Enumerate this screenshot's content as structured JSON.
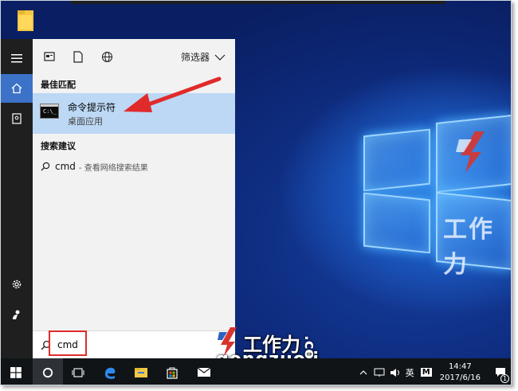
{
  "start_menu": {
    "filter_label": "筛选器",
    "best_match_heading": "最佳匹配",
    "best_match": {
      "title": "命令提示符",
      "subtitle": "桌面应用"
    },
    "suggestions_heading": "搜索建议",
    "suggestion": {
      "query": "cmd",
      "suffix": "- 查看网络搜索结果"
    },
    "search_value": "cmd",
    "icons": [
      "documents-icon",
      "file-icon",
      "web-icon",
      "filter-chevron-icon"
    ]
  },
  "rail": {
    "icons": [
      "hamburger-icon",
      "home-icon",
      "notebook-icon",
      "settings-icon",
      "feedback-icon"
    ]
  },
  "taskbar": {
    "ime": "英",
    "ime_mode": "M",
    "time": "14:47",
    "date": "2017/6/16",
    "notification_count": "1",
    "apps": [
      "windows-start-icon",
      "cortana-icon",
      "task-view-icon",
      "edge-icon",
      "file-explorer-icon",
      "store-icon",
      "mail-icon"
    ]
  },
  "watermark": {
    "brand_cn": "工作力",
    "brand_en": "gongzuoli",
    "brand_tld": ".com"
  },
  "colors": {
    "rail": "#1f1f1f",
    "accent": "#3c72c8",
    "selection": "#bcd8f5",
    "highlight_red": "#e02b2b",
    "taskbar": "#101417"
  }
}
